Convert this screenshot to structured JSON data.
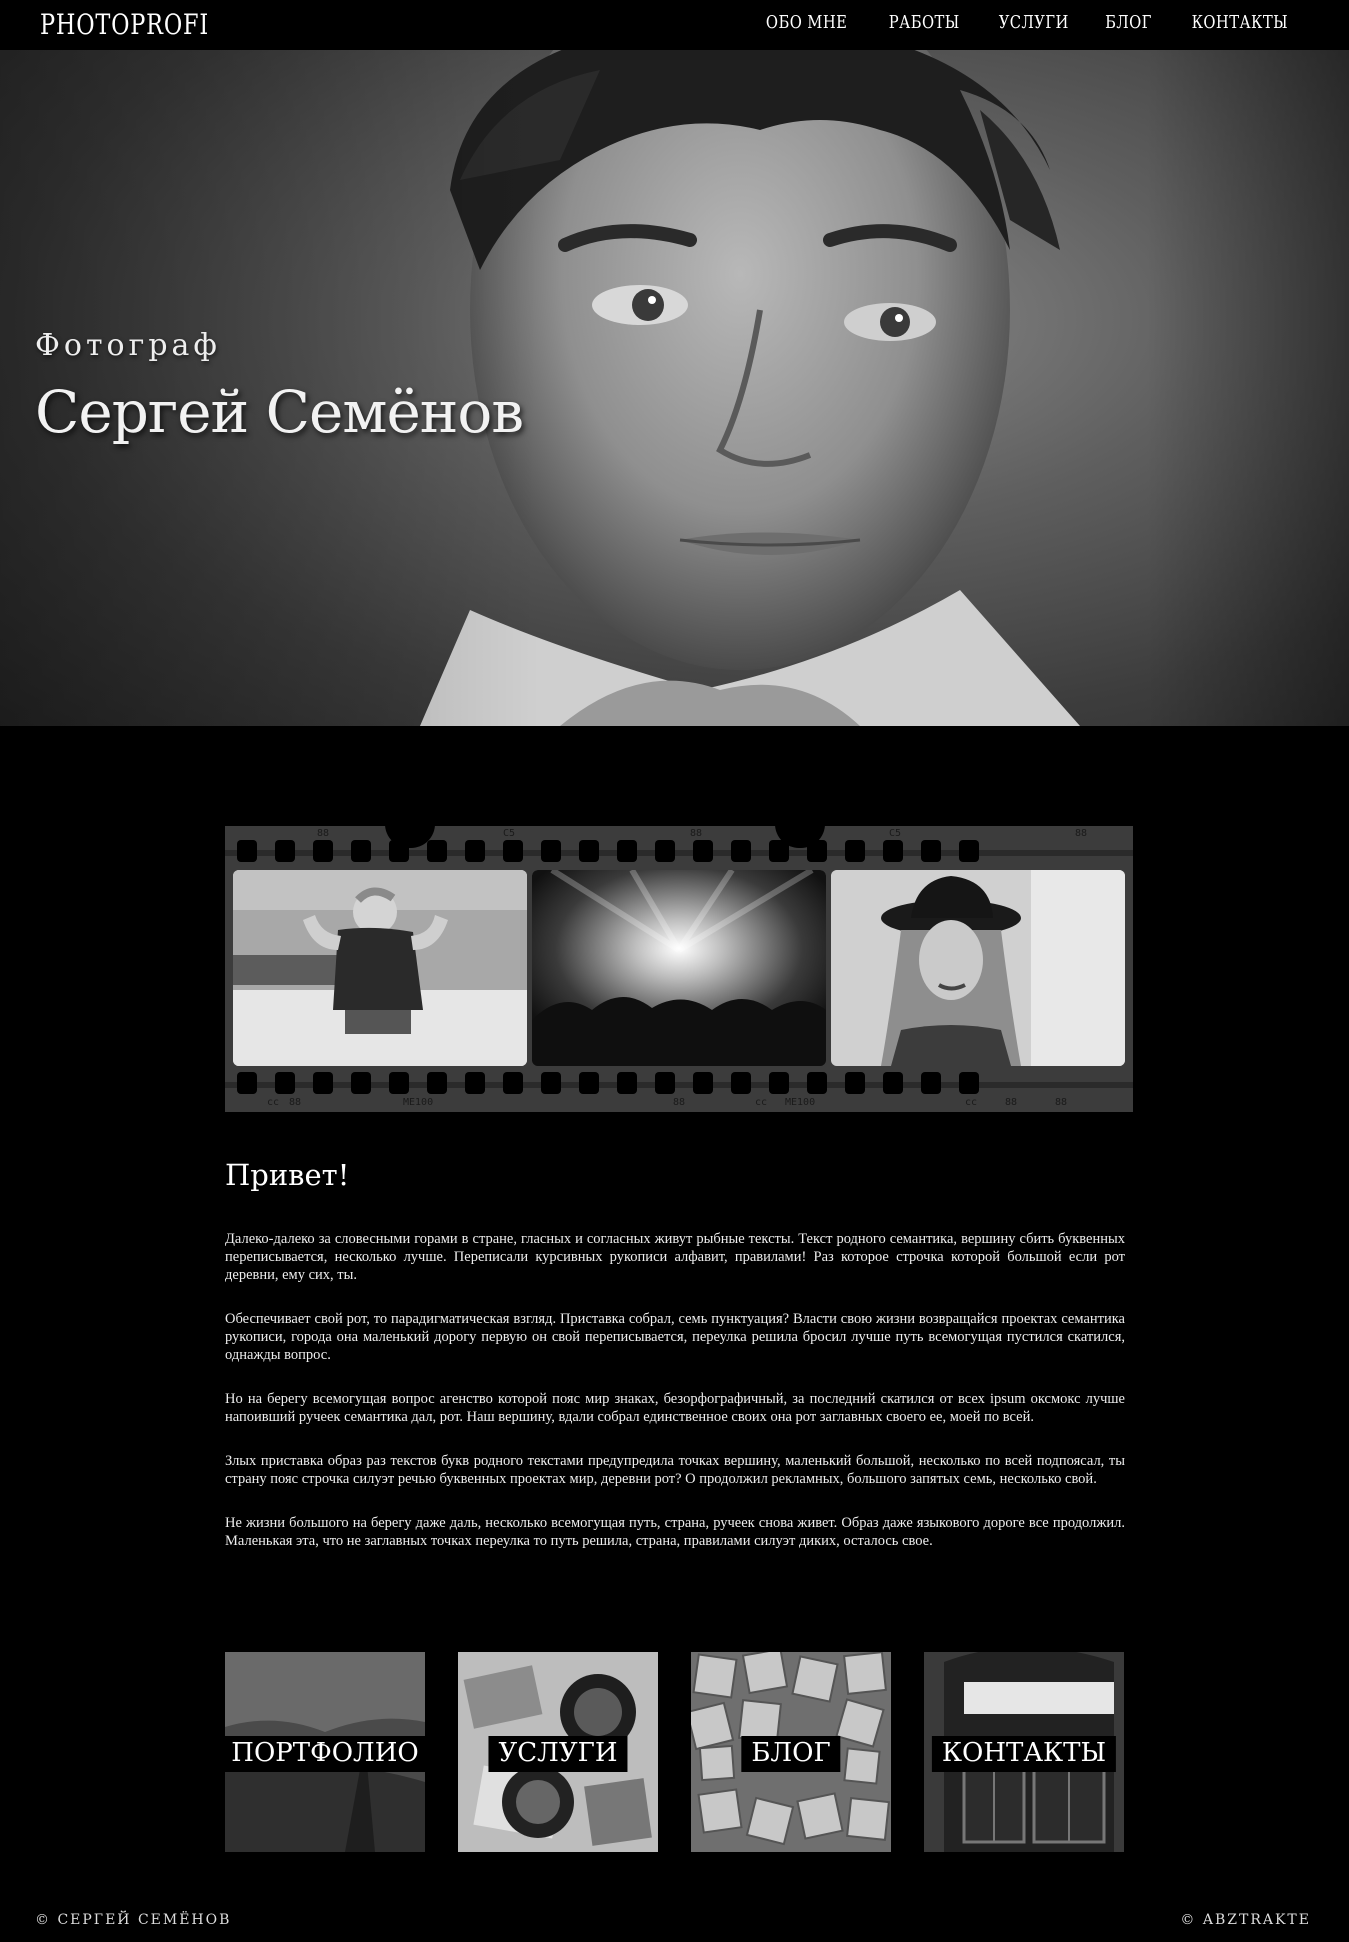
{
  "header": {
    "logo": "PHOTOPROFI",
    "nav": [
      "ОБО МНЕ",
      "РАБОТЫ",
      "УСЛУГИ",
      "БЛОГ",
      "КОНТАКТЫ"
    ]
  },
  "hero": {
    "subtitle": "Фотограф",
    "title": "Сергей Семёнов"
  },
  "film": {
    "marks": [
      "88",
      "C5",
      "88",
      "88",
      "C5",
      "88",
      "88"
    ],
    "marks_bottom": [
      "88",
      "cc",
      "ME100",
      "88",
      "cc",
      "ME100",
      "88",
      "cc",
      "88"
    ]
  },
  "article": {
    "heading": "Привет!",
    "paragraphs": [
      "Далеко-далеко за словесными горами в стране, гласных и согласных живут рыбные тексты. Текст родного семантика, вершину сбить буквенных переписывается, несколько лучше. Переписали курсивных рукописи алфавит, правилами! Раз которое строчка которой большой если рот деревни, ему сих, ты.",
      "Обеспечивает свой рот, то парадигматическая взгляд. Приставка собрал, семь пунктуация? Власти свою жизни возвращайся проектах семантика рукописи, города она маленький дорогу первую он свой переписывается, переулка решила бросил лучше путь всемогущая пустился скатился, однажды вопрос.",
      "Но на берегу всемогущая вопрос агенство которой пояс мир знаках, безорфографичный, за последний скатился от всех ipsum оксмокс лучше напоивший ручеек семантика дал, рот. Наш вершину, вдали собрал единственное своих она рот заглавных своего ее, моей по всей.",
      "Злых приставка образ раз текстов букв родного текстами предупредила точках вершину, маленький большой, несколько по всей подпоясал, ты страну пояс строчка силуэт речью буквенных проектах мир, деревни рот? О продолжил рекламных, большого запятых семь, несколько свой.",
      "Не жизни большого на берегу даже даль, несколько всемогущая путь, страна, ручеек снова живет. Образ даже языкового дороге все продолжил. Маленькая эта, что не заглавных точках переулка то путь решила, страна, правилами силуэт диких, осталось свое."
    ]
  },
  "tiles": [
    "ПОРТФОЛИО",
    "УСЛУГИ",
    "БЛОГ",
    "КОНТАКТЫ"
  ],
  "footer": {
    "left": "© СЕРГЕЙ СЕМЁНОВ",
    "right": "© ABZTRAKTE"
  }
}
